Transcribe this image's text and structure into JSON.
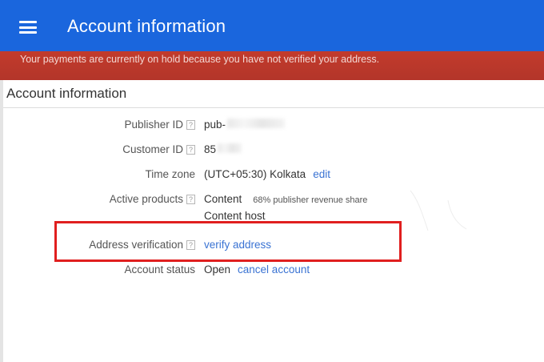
{
  "header": {
    "title": "Account information",
    "menu_icon": "menu-icon",
    "bg_color": "#1a66dd"
  },
  "alert": {
    "text": "Your payments are currently on hold because you have not verified your address.",
    "bg_color": "#b3352a"
  },
  "card": {
    "title": "Account information",
    "help_glyph": "?",
    "rows": {
      "publisher_id": {
        "label": "Publisher ID",
        "value": "pub-"
      },
      "customer_id": {
        "label": "Customer ID",
        "value": "85"
      },
      "time_zone": {
        "label": "Time zone",
        "value": "(UTC+05:30) Kolkata",
        "link": "edit"
      },
      "active_products": {
        "label": "Active products",
        "value": "Content",
        "note": "68% publisher revenue share",
        "value2": "Content host"
      },
      "address_verification": {
        "label": "Address verification",
        "link": "verify address"
      },
      "account_status": {
        "label": "Account status",
        "value": "Open",
        "link": "cancel account"
      }
    }
  },
  "annotation": {
    "box_color": "#e01f1f"
  }
}
